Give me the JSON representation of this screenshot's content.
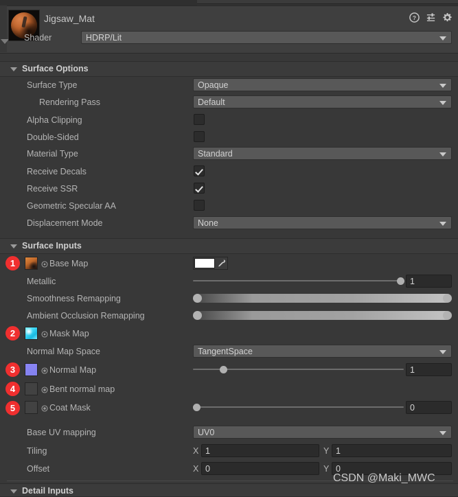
{
  "header": {
    "material_name": "Jigsaw_Mat",
    "shader_label": "Shader",
    "shader_value": "HDRP/Lit",
    "icons": [
      "help-icon",
      "preset-icon",
      "gear-icon"
    ]
  },
  "surface_options": {
    "title": "Surface Options",
    "rows": [
      {
        "label": "Surface Type",
        "type": "dropdown",
        "value": "Opaque",
        "indent": 1
      },
      {
        "label": "Rendering Pass",
        "type": "dropdown",
        "value": "Default",
        "indent": 2
      },
      {
        "label": "Alpha Clipping",
        "type": "checkbox",
        "checked": false,
        "indent": 1
      },
      {
        "label": "Double-Sided",
        "type": "checkbox",
        "checked": false,
        "indent": 1
      },
      {
        "label": "Material Type",
        "type": "dropdown",
        "value": "Standard",
        "indent": 1
      },
      {
        "label": "Receive Decals",
        "type": "checkbox",
        "checked": true,
        "indent": 1
      },
      {
        "label": "Receive SSR",
        "type": "checkbox",
        "checked": true,
        "indent": 1
      },
      {
        "label": "Geometric Specular AA",
        "type": "checkbox",
        "checked": false,
        "indent": 1
      },
      {
        "label": "Displacement Mode",
        "type": "dropdown",
        "value": "None",
        "indent": 1
      }
    ]
  },
  "surface_inputs": {
    "title": "Surface Inputs",
    "rows": [
      {
        "label": "Base Map",
        "type": "texture-color",
        "badge": "1",
        "color": "#ffffff",
        "swatch": "basemap"
      },
      {
        "label": "Metallic",
        "type": "slider",
        "value": "1",
        "fill": 0.985
      },
      {
        "label": "Smoothness Remapping",
        "type": "remap",
        "min": "0",
        "max": "1"
      },
      {
        "label": "Ambient Occlusion Remapping",
        "type": "remap",
        "min": "0",
        "max": "1"
      },
      {
        "label": "Mask Map",
        "type": "texture",
        "badge": "2",
        "swatch": "maskmap"
      },
      {
        "label": "Normal Map Space",
        "type": "dropdown",
        "value": "TangentSpace"
      },
      {
        "label": "Normal Map",
        "type": "texture-slider",
        "badge": "3",
        "value": "1",
        "fill": 0.145,
        "swatch": "normalmap"
      },
      {
        "label": "Bent normal map",
        "type": "texture",
        "badge": "4",
        "swatch": "empty"
      },
      {
        "label": "Coat Mask",
        "type": "texture-slider",
        "badge": "5",
        "value": "0",
        "fill": 0.0,
        "swatch": "empty"
      },
      {
        "label": "Base UV mapping",
        "type": "dropdown",
        "value": "UV0"
      },
      {
        "label": "Tiling",
        "type": "vector2",
        "x_label": "X",
        "x_value": "1",
        "y_label": "Y",
        "y_value": "1"
      },
      {
        "label": "Offset",
        "type": "vector2",
        "x_label": "X",
        "x_value": "0",
        "y_label": "Y",
        "y_value": "0"
      }
    ]
  },
  "detail_inputs": {
    "title": "Detail Inputs"
  },
  "watermark": "CSDN @Maki_MWC",
  "colors": {
    "background": "#383838",
    "header": "#3f3f3f",
    "section": "#3b3b3b",
    "dropdown": "#585858",
    "field": "#2b2b2b",
    "badge": "#f02f2f",
    "text": "#b4b4b4"
  }
}
